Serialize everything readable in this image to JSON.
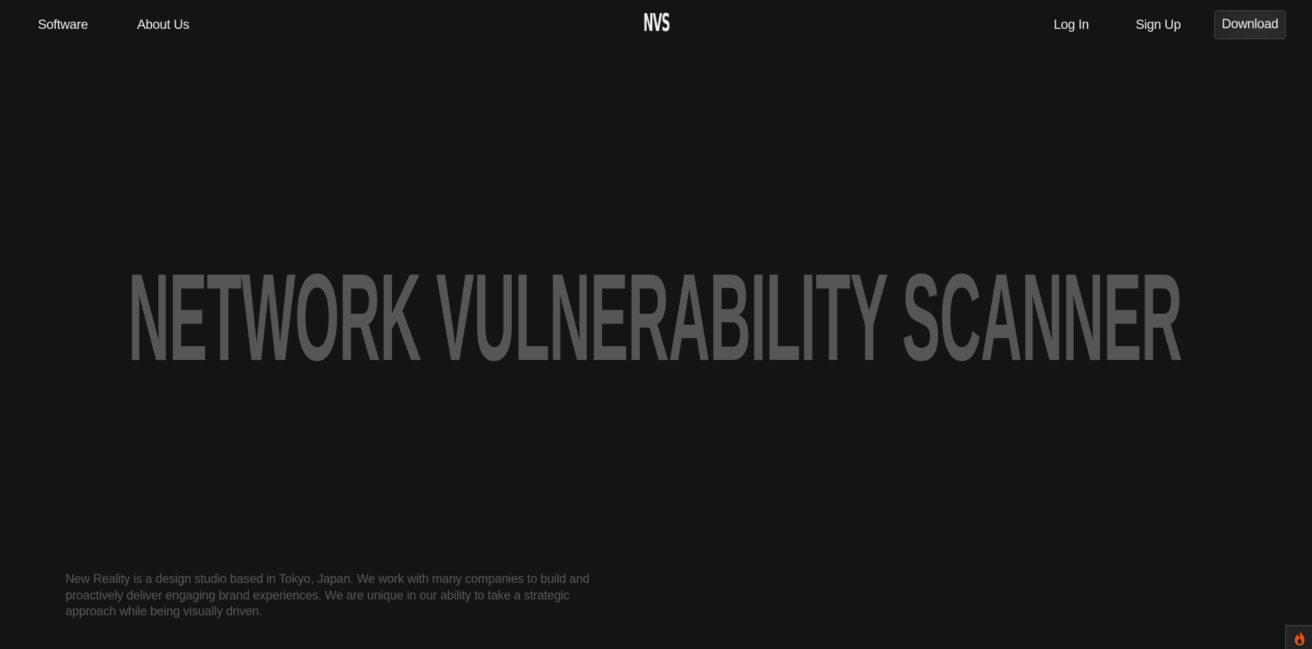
{
  "nav": {
    "left": [
      {
        "label": "Software"
      },
      {
        "label": "About Us"
      }
    ],
    "logo": "NVS",
    "right": [
      {
        "label": "Log In"
      },
      {
        "label": "Sign Up"
      }
    ],
    "download_label": "Download"
  },
  "hero": {
    "title": "NETWORK VULNERABILITY SCANNER"
  },
  "about": {
    "text": "New Reality is a design studio based in Tokyo, Japan. We work with many companies to build and proactively deliver engaging brand experiences. We are unique in our ability to take a strategic approach while being visually driven."
  },
  "corner_badge": {
    "icon": "flame-icon",
    "color": "#e8541c"
  },
  "colors": {
    "background": "#141414",
    "headline": "#565656"
  }
}
